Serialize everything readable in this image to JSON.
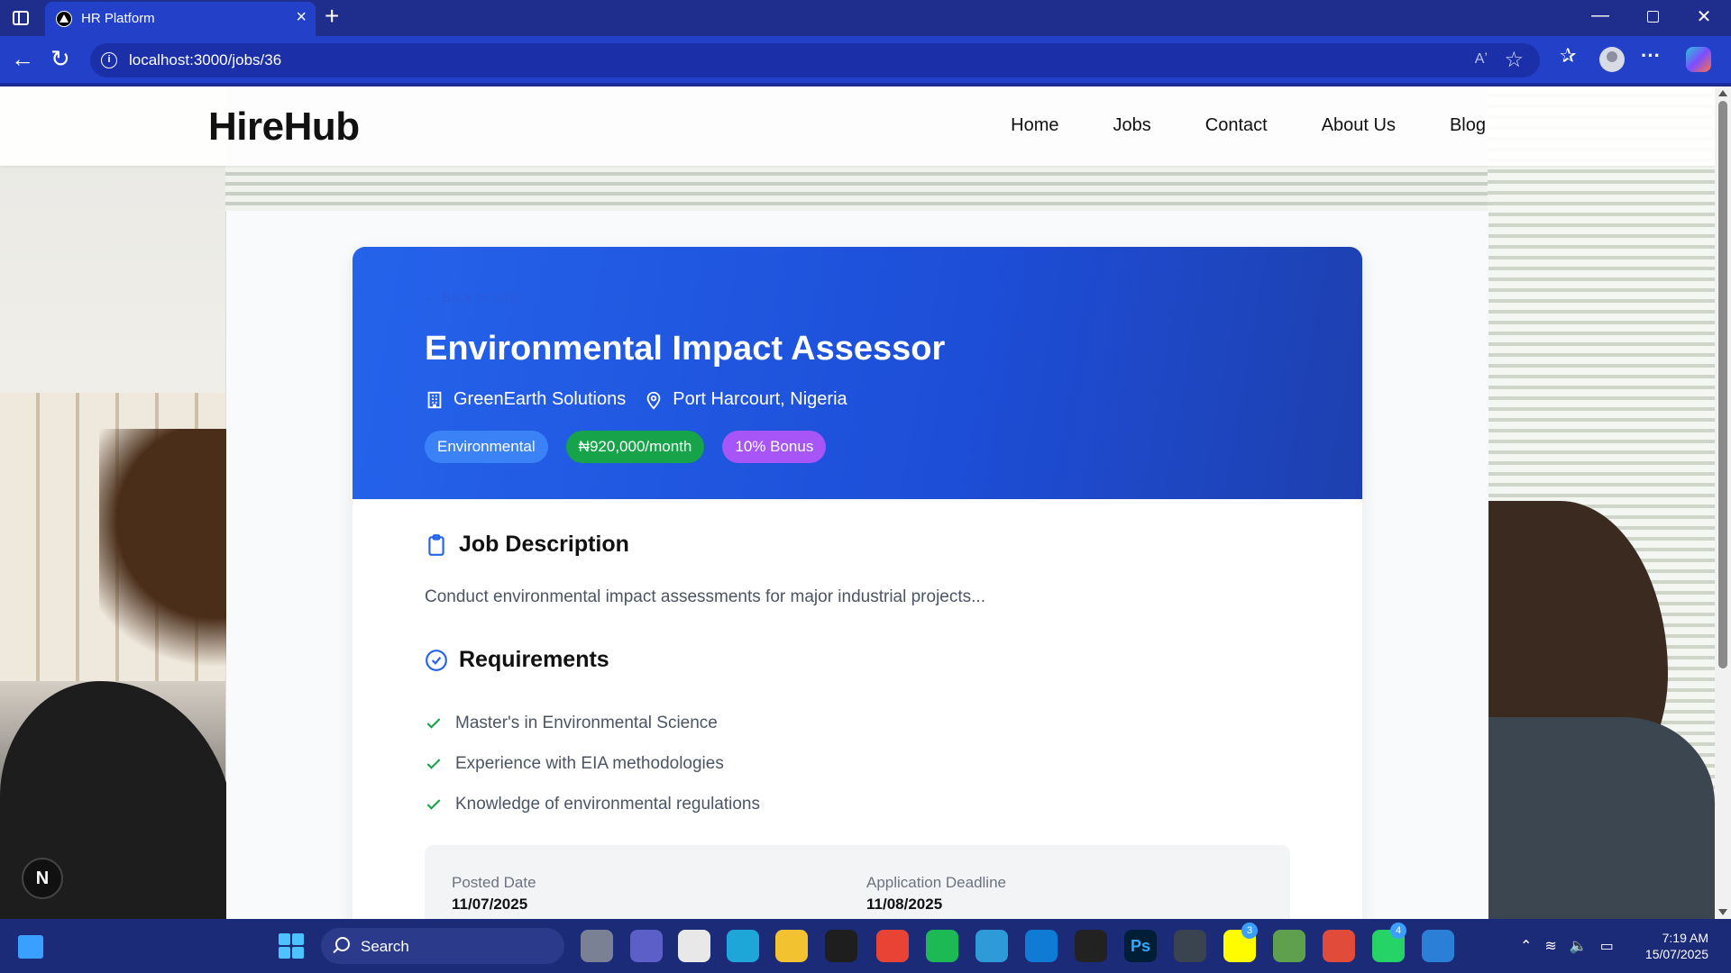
{
  "browser": {
    "tab_title": "HR Platform",
    "url": "localhost:3000/jobs/36",
    "read_aloud_label": "Aʼ"
  },
  "site": {
    "logo": "HireHub",
    "nav": [
      "Home",
      "Jobs",
      "Contact",
      "About Us",
      "Blog"
    ]
  },
  "job": {
    "back_link": "← Back to Jobs",
    "title": "Environmental Impact Assessor",
    "company": "GreenEarth Solutions",
    "location": "Port Harcourt, Nigeria",
    "badges": {
      "category": "Environmental",
      "salary": "₦920,000/month",
      "bonus": "10% Bonus"
    },
    "description_heading": "Job Description",
    "description": "Conduct environmental impact assessments for major industrial projects...",
    "requirements_heading": "Requirements",
    "requirements": [
      "Master's in Environmental Science",
      "Experience with EIA methodologies",
      "Knowledge of environmental regulations"
    ],
    "posted_label": "Posted Date",
    "posted_date": "11/07/2025",
    "deadline_label": "Application Deadline",
    "deadline_date": "11/08/2025"
  },
  "dev_badge": "N",
  "taskbar": {
    "search_label": "Search",
    "time": "7:19 AM",
    "date": "15/07/2025",
    "snapchat_count": "3",
    "whatsapp_count": "4",
    "ps_label": "Ps"
  },
  "colors": {
    "hero_blue": "#1d4ed8",
    "badge_blue": "#3b82f6",
    "badge_green": "#16a34a",
    "badge_purple": "#a855f7",
    "check_green": "#16a34a"
  }
}
